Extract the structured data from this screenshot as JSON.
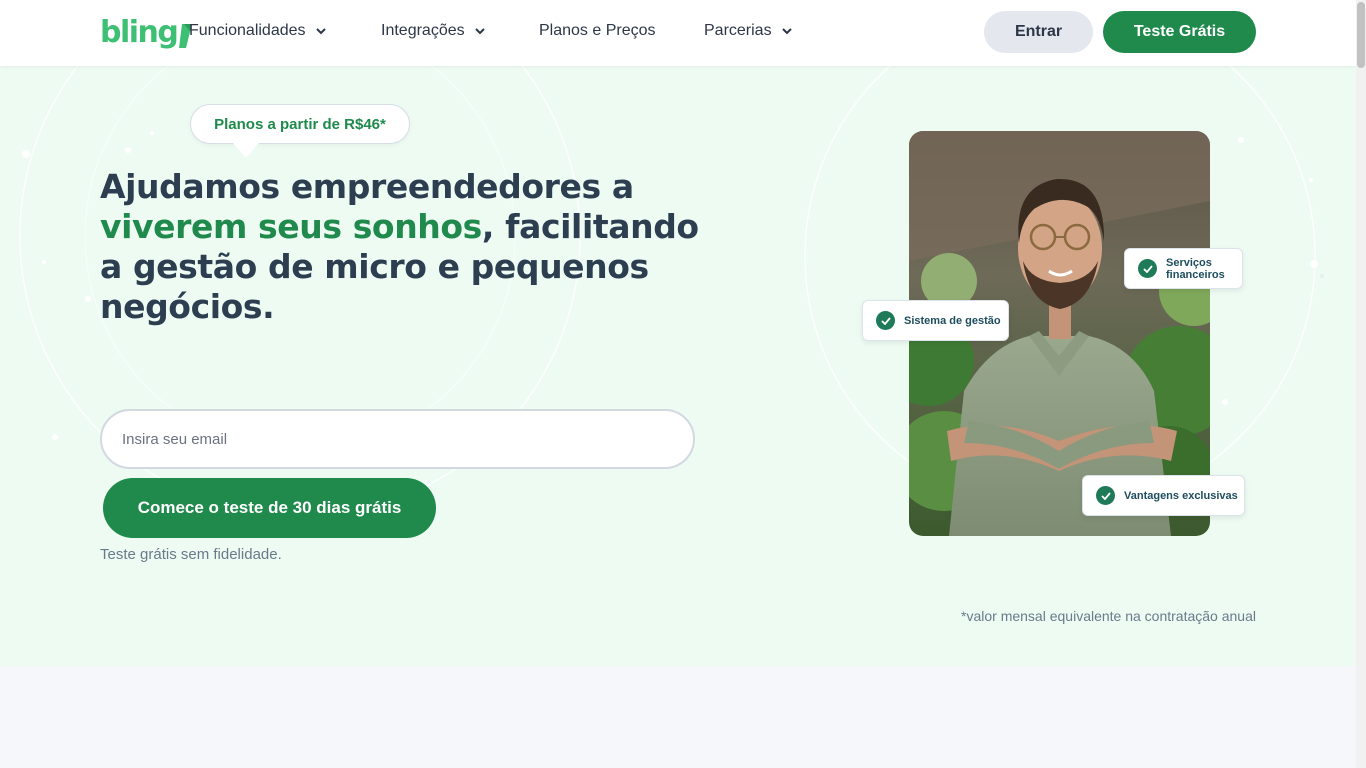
{
  "header": {
    "logo_text": "bling",
    "logo_color": "#3ec074",
    "nav": [
      {
        "label": "Funcionalidades",
        "has_dropdown": true
      },
      {
        "label": "Integrações",
        "has_dropdown": true
      },
      {
        "label": "Planos e Preços",
        "has_dropdown": false
      },
      {
        "label": "Parcerias",
        "has_dropdown": true
      }
    ],
    "login_label": "Entrar",
    "trial_label": "Teste Grátis"
  },
  "hero": {
    "badge": "Planos a partir de R$46*",
    "headline_part1": "Ajudamos empreendedores a ",
    "headline_highlight": "viverem seus sonhos",
    "headline_part2": ", facilitando a gestão de micro e pequenos negócios.",
    "email_placeholder": "Insira seu email",
    "cta_label": "Comece o teste de 30 dias grátis",
    "free_note": "Teste grátis sem fidelidade.",
    "price_note": "*valor mensal equivalente na contratação anual",
    "features": [
      {
        "label": "Sistema de gestão",
        "icon": "check-icon"
      },
      {
        "label": "Serviços financeiros",
        "icon": "check-icon"
      },
      {
        "label": "Vantagens exclusivas",
        "icon": "check-icon"
      }
    ]
  },
  "colors": {
    "brand_green": "#1f8a4c",
    "hero_background": "#edfbf3",
    "text_dark": "#2d3e50"
  }
}
